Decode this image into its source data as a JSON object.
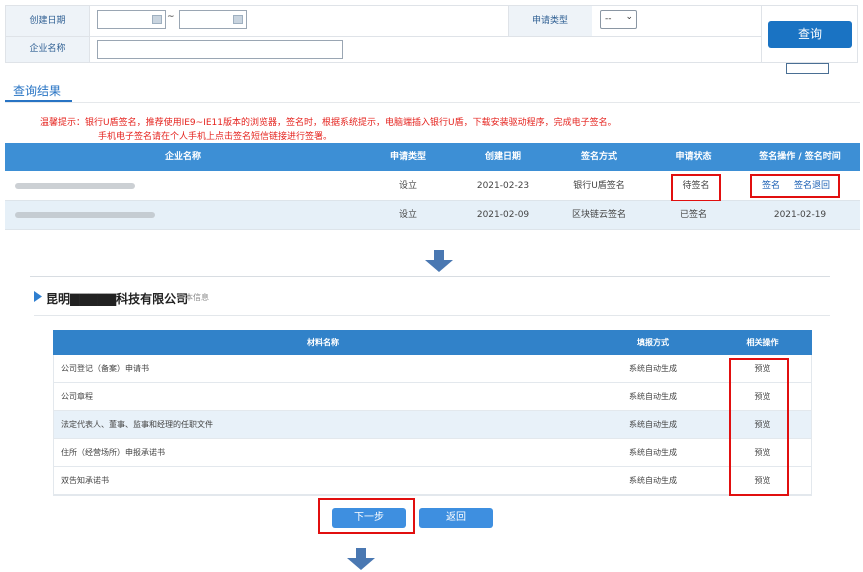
{
  "form": {
    "create_date_label": "创建日期",
    "date_separator": "~",
    "apply_type_label": "申请类型",
    "apply_type_value": "--",
    "company_name_label": "企业名称",
    "query_button": "查询"
  },
  "results": {
    "tab_label": "查询结果",
    "warning_line1": "温馨提示：银行U盾签名，推荐使用IE9~IE11版本的浏览器，签名时，根据系统提示，电脑端插入银行U盾，下载安装驱动程序，完成电子签名。",
    "warning_line2": "手机电子签名请在个人手机上点击签名短信链接进行签署。",
    "headers": [
      "企业名称",
      "申请类型",
      "创建日期",
      "签名方式",
      "申请状态",
      "签名操作 / 签名时间"
    ],
    "rows": [
      {
        "apply_type": "设立",
        "date": "2021-02-23",
        "method": "银行U盾签名",
        "status": "待签名",
        "action1": "签名",
        "action2": "签名退回"
      },
      {
        "apply_type": "设立",
        "date": "2021-02-09",
        "method": "区块链云签名",
        "status": "已签名",
        "sign_time": "2021-02-19"
      }
    ]
  },
  "detail": {
    "company_name": "昆明▇▇▇▇▇科技有限公司",
    "basic_info": "基本信息",
    "headers": [
      "材料名称",
      "填报方式",
      "相关操作"
    ],
    "materials": [
      {
        "name": "公司登记（备案）申请书",
        "mode": "系统自动生成",
        "op": "预览"
      },
      {
        "name": "公司章程",
        "mode": "系统自动生成",
        "op": "预览"
      },
      {
        "name": "法定代表人、董事、监事和经理的任职文件",
        "mode": "系统自动生成",
        "op": "预览"
      },
      {
        "name": "住所（经营场所）申报承诺书",
        "mode": "系统自动生成",
        "op": "预览"
      },
      {
        "name": "双告知承诺书",
        "mode": "系统自动生成",
        "op": "预览"
      }
    ],
    "next_button": "下一步",
    "back_button": "返回"
  },
  "colors": {
    "table_header": "#3d8fd5",
    "highlight": "#e10f0f",
    "warning": "#e5241f",
    "accent": "#1a73c3"
  },
  "icons": [
    "calendar-icon",
    "down-arrow-icon",
    "section-marker-icon"
  ]
}
